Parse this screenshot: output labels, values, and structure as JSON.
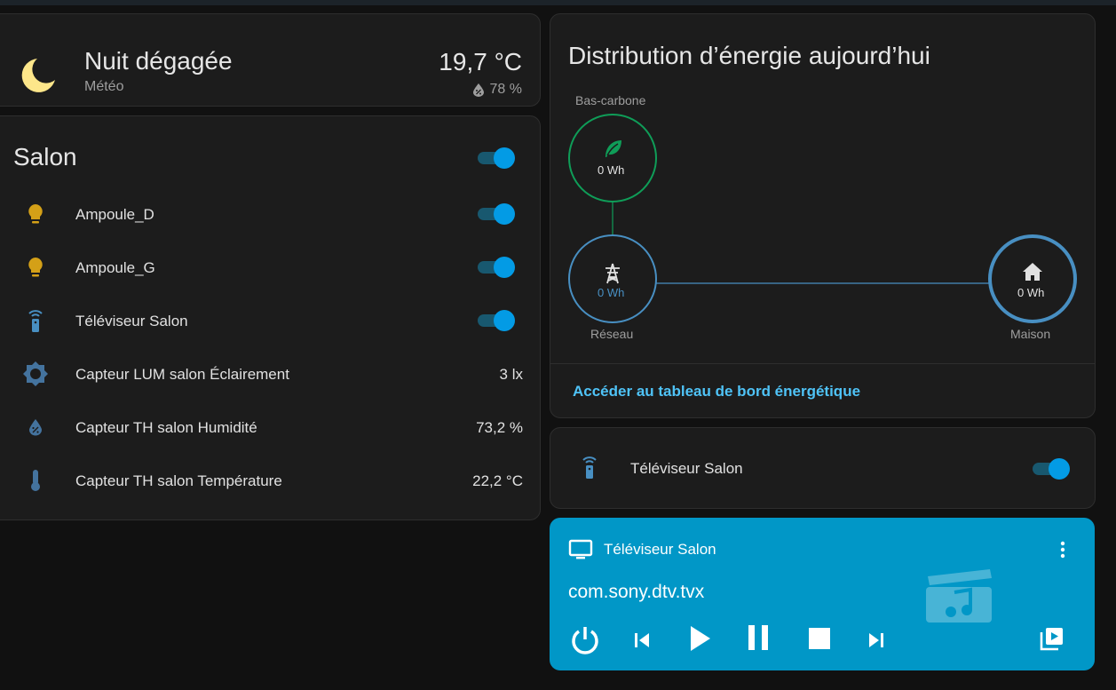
{
  "weather": {
    "condition": "Nuit dégagée",
    "name": "Météo",
    "temperature": "19,7 °C",
    "humidity": "78 %"
  },
  "salon": {
    "title": "Salon",
    "master_toggle": "on",
    "rows": [
      {
        "icon": "lightbulb-icon",
        "label": "Ampoule_D",
        "state": "on"
      },
      {
        "icon": "lightbulb-icon",
        "label": "Ampoule_G",
        "state": "on"
      },
      {
        "icon": "remote-tv-icon",
        "label": "Téléviseur Salon",
        "state": "on"
      },
      {
        "icon": "brightness-icon",
        "label": "Capteur LUM salon Éclairement",
        "value": "3 lx"
      },
      {
        "icon": "water-percent-icon",
        "label": "Capteur TH salon Humidité",
        "value": "73,2 %"
      },
      {
        "icon": "thermometer-icon",
        "label": "Capteur TH salon Température",
        "value": "22,2 °C"
      }
    ]
  },
  "energy": {
    "title": "Distribution d’énergie aujourd’hui",
    "low_carbon": {
      "label": "Bas-carbone",
      "value": "0 Wh",
      "icon": "leaf-icon",
      "color": "#0f9d58"
    },
    "grid": {
      "label": "Réseau",
      "value": "0 Wh",
      "icon": "transmission-tower-icon",
      "color": "#488fc2"
    },
    "home": {
      "label": "Maison",
      "value": "0 Wh",
      "icon": "home-icon",
      "color": "#488fc2"
    },
    "link": "Accéder au tableau de bord énergétique"
  },
  "tv_card": {
    "label": "Téléviseur Salon",
    "icon": "remote-tv-icon",
    "state": "on"
  },
  "media": {
    "title": "Téléviseur Salon",
    "app": "com.sony.dtv.tvx",
    "background": "#0197c7",
    "controls": [
      "power-icon",
      "skip-previous-icon",
      "play-icon",
      "pause-icon",
      "stop-icon",
      "skip-next-icon",
      "playlist-play-icon"
    ]
  },
  "colors": {
    "accent": "#039be5",
    "bulb": "#d4a017",
    "sensor": "#44739e",
    "link": "#4fc3f7"
  }
}
